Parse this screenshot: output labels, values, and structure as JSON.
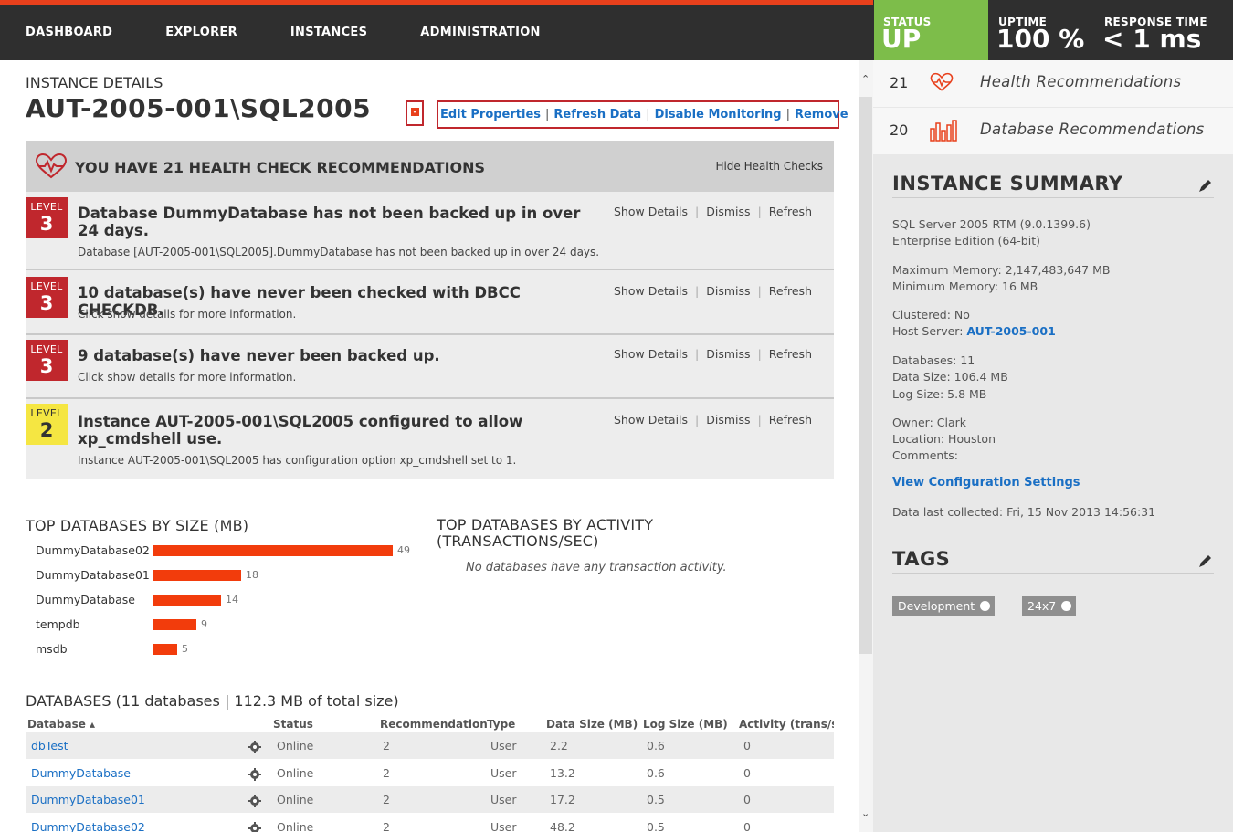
{
  "nav": {
    "items": [
      "DASHBOARD",
      "EXPLORER",
      "INSTANCES",
      "ADMINISTRATION"
    ]
  },
  "kpis": {
    "status": {
      "label": "STATUS",
      "value": "UP",
      "color": "#7dbd4a"
    },
    "uptime": {
      "label": "UPTIME",
      "value": "100 %"
    },
    "response": {
      "label": "RESPONSE TIME",
      "value": "< 1 ms"
    }
  },
  "instance": {
    "label": "INSTANCE DETAILS",
    "name": "AUT-2005-001\\SQL2005",
    "actions": {
      "edit": "Edit Properties",
      "refresh": "Refresh Data",
      "disable": "Disable Monitoring",
      "remove": "Remove"
    }
  },
  "health": {
    "title": "YOU HAVE 21 HEALTH CHECK RECOMMENDATIONS",
    "hide_label": "Hide Health Checks",
    "action_labels": {
      "details": "Show Details",
      "dismiss": "Dismiss",
      "refresh": "Refresh"
    },
    "level_word": "LEVEL",
    "recommendations": [
      {
        "level": "3",
        "title": "Database DummyDatabase has not been backed up in over 24 days.",
        "desc": "Database [AUT-2005-001\\SQL2005].DummyDatabase has not been backed up in over 24 days."
      },
      {
        "level": "3",
        "title": "10 database(s) have never been checked with DBCC CHECKDB.",
        "desc": "Click show details for more information."
      },
      {
        "level": "3",
        "title": "9 database(s) have never been backed up.",
        "desc": "Click show details for more information."
      },
      {
        "level": "2",
        "title": "Instance AUT-2005-001\\SQL2005 configured to allow xp_cmdshell use.",
        "desc": "Instance AUT-2005-001\\SQL2005 has configuration option xp_cmdshell set to 1."
      }
    ]
  },
  "size_chart": {
    "title": "TOP DATABASES BY SIZE (MB)",
    "bar_color": "#f23c0c"
  },
  "chart_data": {
    "type": "bar",
    "orientation": "horizontal",
    "categories": [
      "DummyDatabase02",
      "DummyDatabase01",
      "DummyDatabase",
      "tempdb",
      "msdb"
    ],
    "values": [
      49,
      18,
      14,
      9,
      5
    ],
    "title": "TOP DATABASES BY SIZE (MB)",
    "xlabel": "",
    "ylabel": "",
    "xlim": [
      0,
      49
    ]
  },
  "activity_chart": {
    "title_line1": "TOP DATABASES BY ACTIVITY",
    "title_line2": "(TRANSACTIONS/SEC)",
    "empty_message": "No databases have any transaction activity."
  },
  "databases": {
    "title": "DATABASES (11 databases | 112.3 MB of total size)",
    "columns": [
      "Database ▴",
      "Status",
      "Recommendation",
      "Type",
      "Data Size (MB)",
      "Log Size (MB)",
      "Activity (trans/s"
    ],
    "rows": [
      {
        "name": "dbTest",
        "status": "Online",
        "recs": "2",
        "type": "User",
        "data": "2.2",
        "log": "0.6",
        "activity": "0"
      },
      {
        "name": "DummyDatabase",
        "status": "Online",
        "recs": "2",
        "type": "User",
        "data": "13.2",
        "log": "0.6",
        "activity": "0"
      },
      {
        "name": "DummyDatabase01",
        "status": "Online",
        "recs": "2",
        "type": "User",
        "data": "17.2",
        "log": "0.5",
        "activity": "0"
      },
      {
        "name": "DummyDatabase02",
        "status": "Online",
        "recs": "2",
        "type": "User",
        "data": "48.2",
        "log": "0.5",
        "activity": "0"
      }
    ]
  },
  "side": {
    "health_recs": {
      "count": "21",
      "label": "Health Recommendations"
    },
    "db_recs": {
      "count": "20",
      "label": "Database Recommendations"
    },
    "summary": {
      "title": "INSTANCE SUMMARY",
      "version": "SQL Server 2005 RTM (9.0.1399.6)",
      "edition": "Enterprise Edition (64-bit)",
      "max_memory": "Maximum Memory: 2,147,483,647 MB",
      "min_memory": "Minimum Memory: 16 MB",
      "clustered": "Clustered: No",
      "host_label": "Host Server: ",
      "host_value": "AUT-2005-001",
      "databases": "Databases: 11",
      "data_size": "Data Size: 106.4 MB",
      "log_size": "Log Size: 5.8 MB",
      "owner": "Owner: Clark",
      "location": "Location: Houston",
      "comments": "Comments:",
      "config_link": "View Configuration Settings",
      "last_collected": "Data last collected: Fri, 15 Nov 2013 14:56:31"
    },
    "tags": {
      "title": "TAGS",
      "items": [
        "Development",
        "24x7"
      ]
    }
  }
}
